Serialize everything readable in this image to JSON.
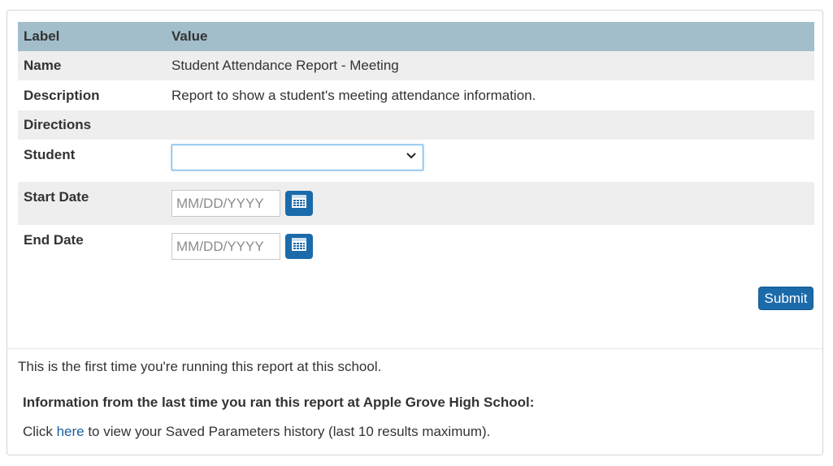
{
  "table": {
    "header_label": "Label",
    "header_value": "Value",
    "name_label": "Name",
    "name_value": "Student Attendance Report - Meeting",
    "description_label": "Description",
    "description_value": "Report to show a student's meeting attendance information.",
    "directions_label": "Directions",
    "directions_value": "",
    "student_label": "Student",
    "student_selected": "",
    "start_date_label": "Start Date",
    "start_date_placeholder": "MM/DD/YYYY",
    "end_date_label": "End Date",
    "end_date_placeholder": "MM/DD/YYYY"
  },
  "actions": {
    "submit_label": "Submit"
  },
  "footer": {
    "first_time_text": "This is the first time you're running this report at this school.",
    "info_heading": "Information from the last time you ran this report at Apple Grove High School:",
    "history_prefix": "Click ",
    "history_link": "here",
    "history_suffix": " to view your Saved Parameters history (last 10 results maximum)."
  },
  "colors": {
    "header_bg": "#a3becb",
    "alt_row_bg": "#eeeeee",
    "button_blue": "#1b6aaa",
    "link_blue": "#1a5f9e"
  },
  "icons": {
    "dropdown": "chevron-down-icon",
    "calendar": "calendar-icon"
  }
}
